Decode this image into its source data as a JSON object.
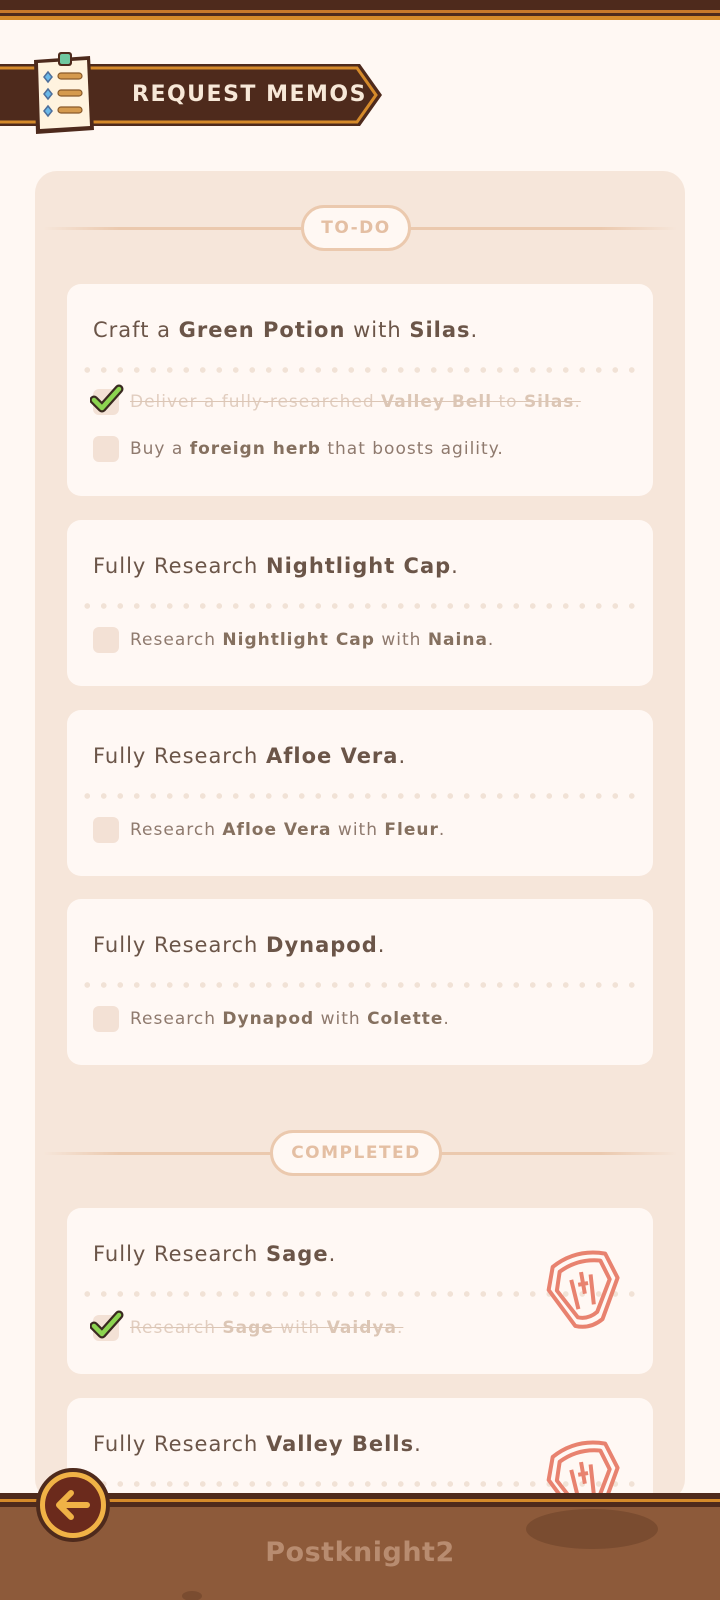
{
  "header": {
    "title": "REQUEST MEMOS"
  },
  "sections": {
    "todo_label": "TO-DO",
    "completed_label": "COMPLETED"
  },
  "todo_cards": [
    {
      "title_pre": "Craft a ",
      "title_b1": "Green Potion",
      "title_mid": " with ",
      "title_b2": "Silas",
      "title_post": ".",
      "tasks": [
        {
          "pre": "Deliver a fully-researched ",
          "b1": "Valley Bell",
          "mid": " to ",
          "b2": "Silas",
          "post": ".",
          "done": true
        },
        {
          "pre": "Buy a ",
          "b1": "foreign herb",
          "mid": " that boosts agility.",
          "b2": "",
          "post": "",
          "done": false
        }
      ]
    },
    {
      "title_pre": "Fully Research ",
      "title_b1": "Nightlight Cap",
      "title_post": ".",
      "tasks": [
        {
          "pre": "Research ",
          "b1": "Nightlight Cap",
          "mid": " with ",
          "b2": "Naina",
          "post": ".",
          "done": false
        }
      ]
    },
    {
      "title_pre": "Fully Research ",
      "title_b1": "Afloe Vera",
      "title_post": ".",
      "tasks": [
        {
          "pre": "Research ",
          "b1": "Afloe Vera",
          "mid": " with ",
          "b2": "Fleur",
          "post": ".",
          "done": false
        }
      ]
    },
    {
      "title_pre": "Fully Research ",
      "title_b1": "Dynapod",
      "title_post": ".",
      "tasks": [
        {
          "pre": "Research ",
          "b1": "Dynapod",
          "mid": " with ",
          "b2": "Colette",
          "post": ".",
          "done": false
        }
      ]
    }
  ],
  "completed_cards": [
    {
      "title_pre": "Fully Research ",
      "title_b1": "Sage",
      "title_post": ".",
      "tasks": [
        {
          "pre": "Research ",
          "b1": "Sage",
          "mid": " with ",
          "b2": "Vaidya",
          "post": ".",
          "done": true
        }
      ]
    },
    {
      "title_pre": "Fully Research ",
      "title_b1": "Valley Bells",
      "title_post": ".",
      "tasks": []
    }
  ],
  "footer": {
    "brand": "Postknight2"
  },
  "icons": {
    "memo": "clipboard-memo-icon",
    "check": "green-checkmark-icon",
    "stamp": "completed-stamp-icon",
    "back": "back-arrow-icon"
  },
  "colors": {
    "accent_dark": "#4e2a1c",
    "accent_orange": "#d58a2a",
    "panel": "#f6e6da",
    "card": "#fff8f4",
    "stamp": "#e8826f",
    "check": "#8cd450"
  }
}
